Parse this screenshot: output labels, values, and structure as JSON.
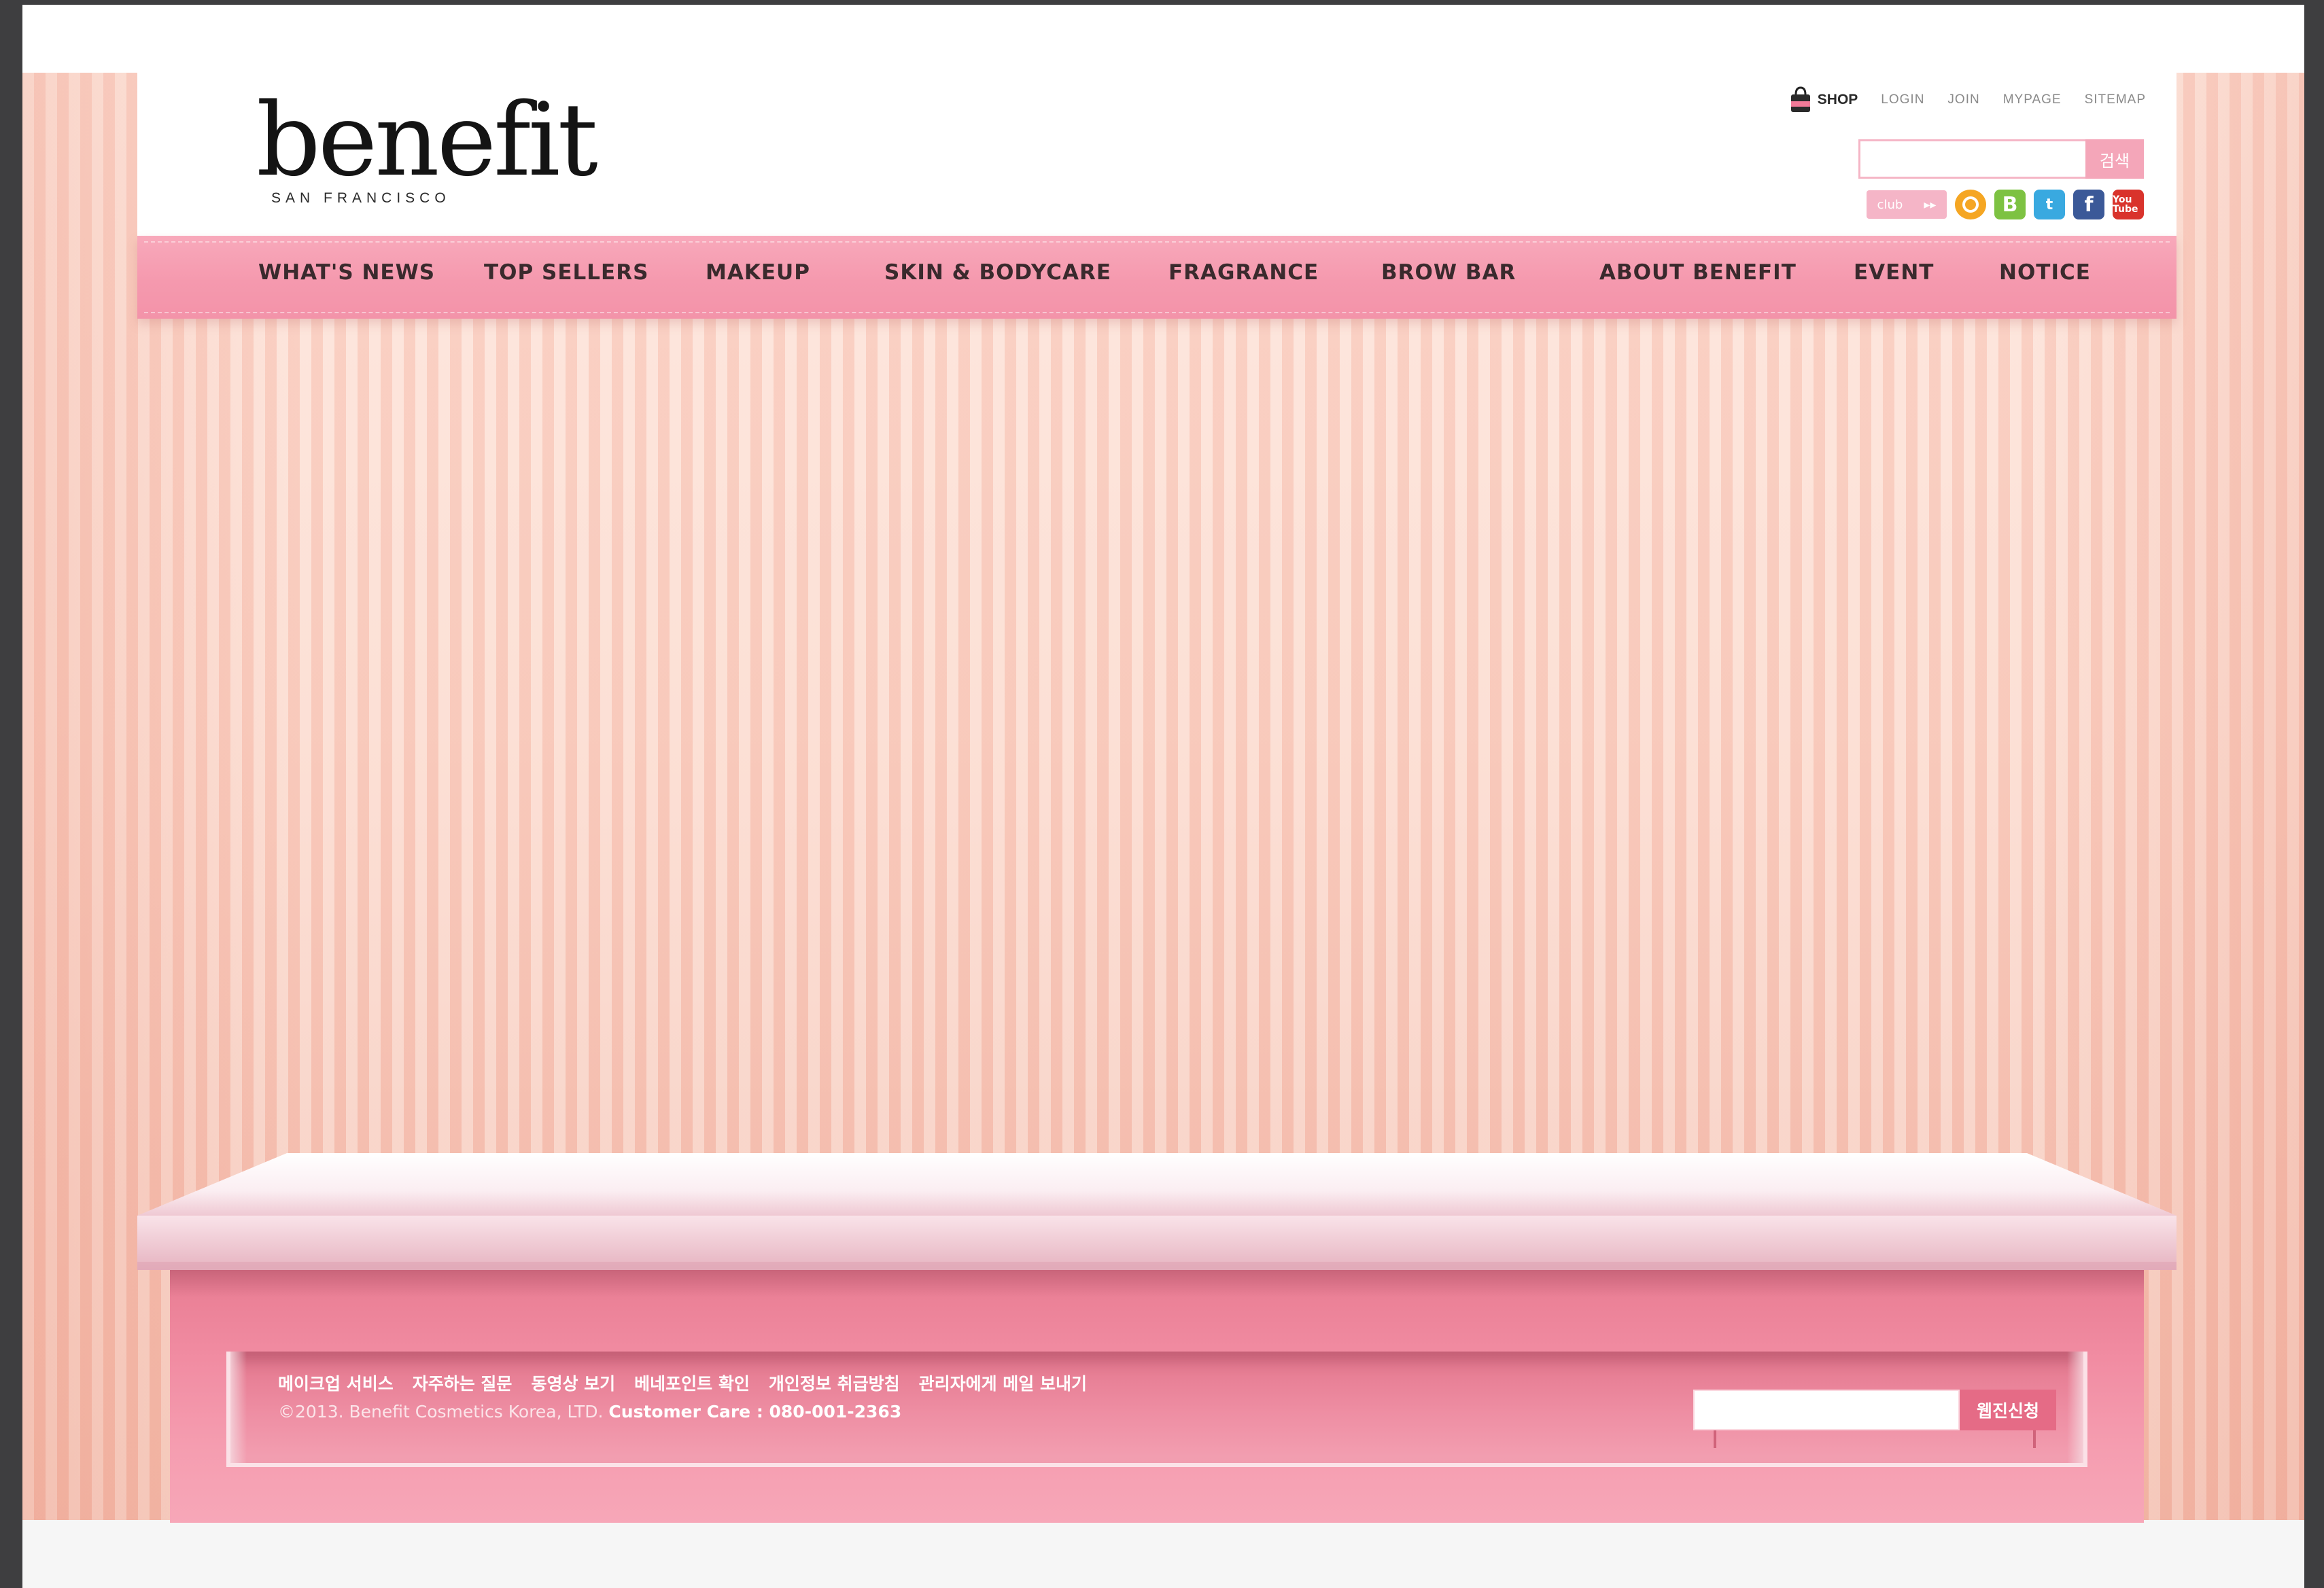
{
  "brand": {
    "logo_word": "benefit",
    "logo_sub": "SAN FRANCISCO"
  },
  "utility": {
    "shop": "SHOP",
    "links": [
      "LOGIN",
      "JOIN",
      "MYPAGE",
      "SITEMAP"
    ]
  },
  "search": {
    "value": "",
    "button": "검색"
  },
  "social": {
    "club_label": "club",
    "icons": [
      "ring-icon",
      "blog-icon",
      "twitter-icon",
      "facebook-icon",
      "youtube-icon"
    ],
    "blog_glyph": "B",
    "twitter_glyph": "t",
    "facebook_glyph": "f",
    "youtube_glyph": "You Tube"
  },
  "nav": {
    "items": [
      "WHAT'S NEWS",
      "TOP SELLERS",
      "MAKEUP",
      "SKIN & BODYCARE",
      "FRAGRANCE",
      "BROW BAR",
      "ABOUT BENEFIT",
      "EVENT",
      "NOTICE"
    ]
  },
  "footer": {
    "links": [
      "메이크업 서비스",
      "자주하는 질문",
      "동영상 보기",
      "베네포인트 확인",
      "개인정보 취급방침",
      "관리자에게 메일 보내기"
    ],
    "copyright": "©2013. Benefit Cosmetics Korea, LTD.",
    "customer_care": "Customer Care : 080-001-2363",
    "newsletter_value": "",
    "newsletter_button": "웹진신청"
  },
  "colors": {
    "nav_pink": "#f599ae",
    "shelf_pink": "#f18ca2",
    "accent_button": "#e56b86",
    "wall_stripe": "#fbd6c8"
  }
}
